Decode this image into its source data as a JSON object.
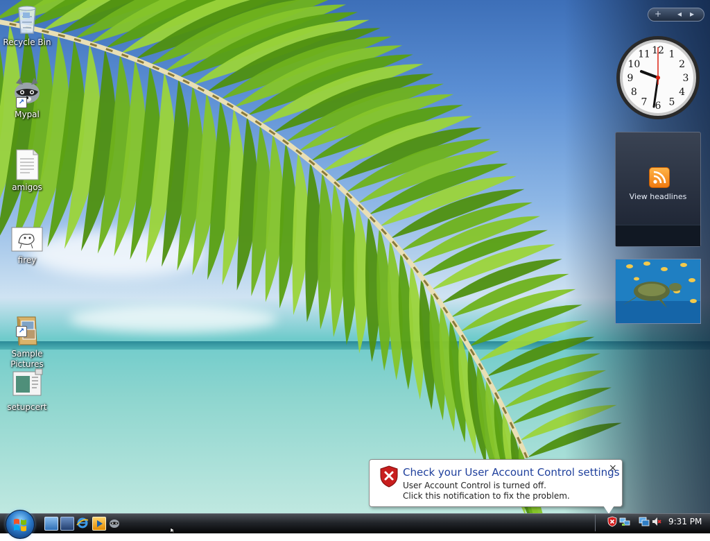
{
  "desktop": {
    "icons": [
      {
        "label": "Recycle Bin",
        "icon": "recycle-bin-icon"
      },
      {
        "label": "Mypal",
        "icon": "mypal-raccoon-icon"
      },
      {
        "label": "amigos",
        "icon": "text-document-icon"
      },
      {
        "label": "firey",
        "icon": "image-file-icon"
      },
      {
        "label": "Sample\nPictures",
        "icon": "folder-shortcut-icon"
      },
      {
        "label": "setupcert",
        "icon": "setup-file-icon"
      }
    ]
  },
  "sidebar": {
    "control_add": "+",
    "control_prev": "◂",
    "control_next": "▸",
    "clock": {
      "numbers": [
        "12",
        "1",
        "2",
        "3",
        "4",
        "5",
        "6",
        "7",
        "8",
        "9",
        "10",
        "11"
      ]
    },
    "feed_gadget": {
      "label": "View headlines",
      "icon": "rss-feed-icon"
    },
    "slideshow": {
      "icon": "sea-turtle-photo"
    }
  },
  "notification": {
    "title": "Check your User Account Control settings",
    "line1": "User Account Control is turned off.",
    "line2": "Click this notification to fix the problem.",
    "close": "×",
    "icon": "security-shield-error-icon"
  },
  "taskbar": {
    "start_icon": "windows-start-orb",
    "quick_launch": [
      "show-desktop-icon",
      "switch-windows-icon",
      "internet-explorer-icon",
      "media-player-icon",
      "mypal-icon"
    ],
    "tray_icons": [
      "security-alert-icon",
      "network-icon",
      "connection-icon",
      "volume-muted-icon"
    ],
    "time": "9:31 PM"
  },
  "colors": {
    "balloon_title": "#1e3f9c",
    "taskbar_top": "#4b4f56",
    "rss_orange": "#f07a10"
  }
}
